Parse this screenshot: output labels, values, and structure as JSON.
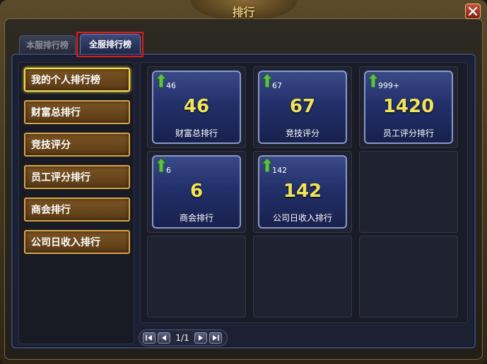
{
  "window": {
    "title": "排行"
  },
  "tabs": [
    {
      "label": "本服排行榜",
      "selected": false
    },
    {
      "label": "全服排行榜",
      "selected": true
    }
  ],
  "sidebar": {
    "items": [
      {
        "label": "我的个人排行榜",
        "active": true
      },
      {
        "label": "财富总排行",
        "active": false
      },
      {
        "label": "竞技评分",
        "active": false
      },
      {
        "label": "员工评分排行",
        "active": false
      },
      {
        "label": "商会排行",
        "active": false
      },
      {
        "label": "公司日收入排行",
        "active": false
      }
    ]
  },
  "rank_cards": [
    {
      "trend_icon": "up-arrow-icon",
      "previous": "46",
      "rank": "46",
      "label": "财富总排行"
    },
    {
      "trend_icon": "up-arrow-icon",
      "previous": "67",
      "rank": "67",
      "label": "竞技评分"
    },
    {
      "trend_icon": "up-arrow-icon",
      "previous": "999+",
      "rank": "1420",
      "label": "员工评分排行"
    },
    {
      "trend_icon": "up-arrow-icon",
      "previous": "6",
      "rank": "6",
      "label": "商会排行"
    },
    {
      "trend_icon": "up-arrow-icon",
      "previous": "142",
      "rank": "142",
      "label": "公司日收入排行"
    }
  ],
  "pagination": {
    "text": "1/1"
  },
  "colors": {
    "accent": "#f2e35a",
    "highlight_box": "#e3181f",
    "sidebar_active_border": "#f4df4a"
  }
}
